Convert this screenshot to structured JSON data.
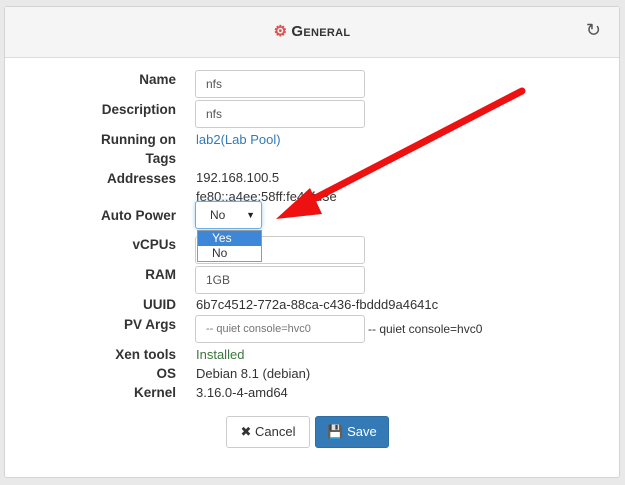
{
  "header": {
    "title": "General",
    "gear_icon": "gears-icon",
    "refresh_icon": "refresh-icon"
  },
  "labels": {
    "name": "Name",
    "description": "Description",
    "running_on": "Running on",
    "tags": "Tags",
    "addresses": "Addresses",
    "auto_power": "Auto Power",
    "vcpus": "vCPUs",
    "ram": "RAM",
    "uuid": "UUID",
    "pv_args": "PV Args",
    "xen_tools": "Xen tools",
    "os": "OS",
    "kernel": "Kernel"
  },
  "fields": {
    "name": "nfs",
    "description": "nfs",
    "running_on_host": "lab2",
    "running_on_pool": "Lab Pool",
    "address_v4": "192.168.100.5",
    "address_v6": "fe80::a4ee:58ff:fe4f:fd3e",
    "auto_power_selected": "No",
    "auto_power_options": [
      "Yes",
      "No"
    ],
    "ram": "1GB",
    "uuid": "6b7c4512-772a-88ca-c436-fbddd9a4641c",
    "pv_args_placeholder": "-- quiet console=hvc0",
    "pv_args_default": "-- quiet console=hvc0",
    "xen_tools": "Installed",
    "os": "Debian 8.1 (debian)",
    "kernel": "3.16.0-4-amd64"
  },
  "buttons": {
    "cancel": "Cancel",
    "save": "Save"
  },
  "colors": {
    "accent": "#337ab7",
    "gear": "#d9534f",
    "arrow": "#ee1111",
    "installed": "#3c763d"
  }
}
